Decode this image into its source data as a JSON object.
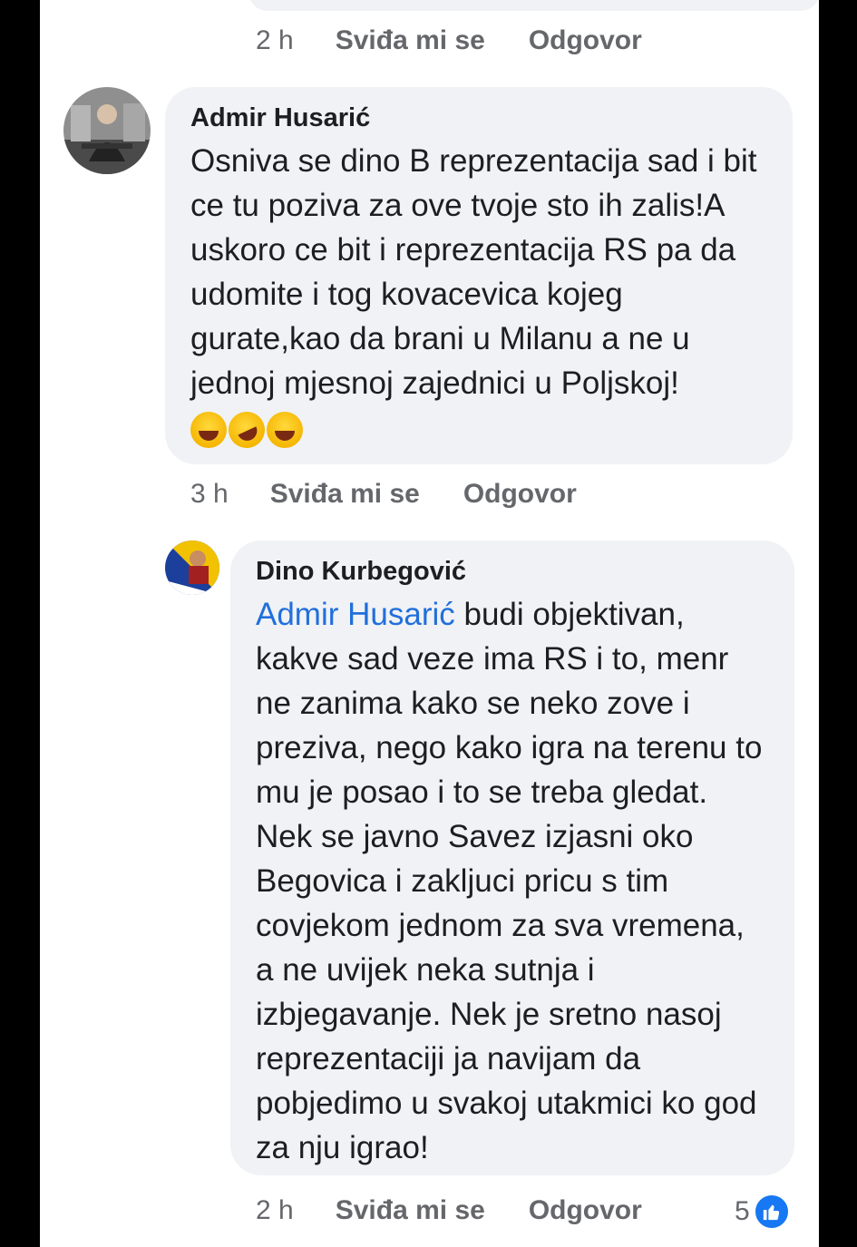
{
  "top_comment": {
    "time": "2 h",
    "like_label": "Sviđa mi se",
    "reply_label": "Odgovor"
  },
  "comments": [
    {
      "author": "Admir Husarić",
      "text": "Osniva se dino B reprezentacija sad i bit ce tu poziva za ove tvoje sto ih zalis!A uskoro ce bit i reprezentacija RS pa da udomite i tog kovacevica kojeg gurate,kao da brani u Milanu a ne u jednoj mjesnoj zajednici u Poljskoj!",
      "emojis": [
        "laughing-tears-emoji",
        "rolling-laughing-emoji",
        "laughing-tears-emoji"
      ],
      "time": "3 h",
      "like_label": "Sviđa mi se",
      "reply_label": "Odgovor"
    },
    {
      "author": "Dino Kurbegović",
      "mention": "Admir Husarić",
      "text": " budi objektivan, kakve sad veze ima RS i to, menr ne zanima kako se neko zove i preziva, nego kako igra na terenu to mu je posao i to se treba gledat. Nek se javno Savez izjasni oko Begovica i zakljuci pricu s tim covjekom jednom za sva vremena, a ne uvijek neka sutnja i izbjegavanje. Nek je sretno nasoj reprezentaciji ja navijam da pobjedimo u svakoj utakmici ko god za nju igrao!",
      "time": "2 h",
      "like_label": "Sviđa mi se",
      "reply_label": "Odgovor",
      "reaction_count": "5",
      "reaction_icon": "like-icon"
    }
  ],
  "colors": {
    "bubble": "#f0f2f5",
    "mention": "#216fdb",
    "like": "#1877f2",
    "meta": "#65676b"
  }
}
